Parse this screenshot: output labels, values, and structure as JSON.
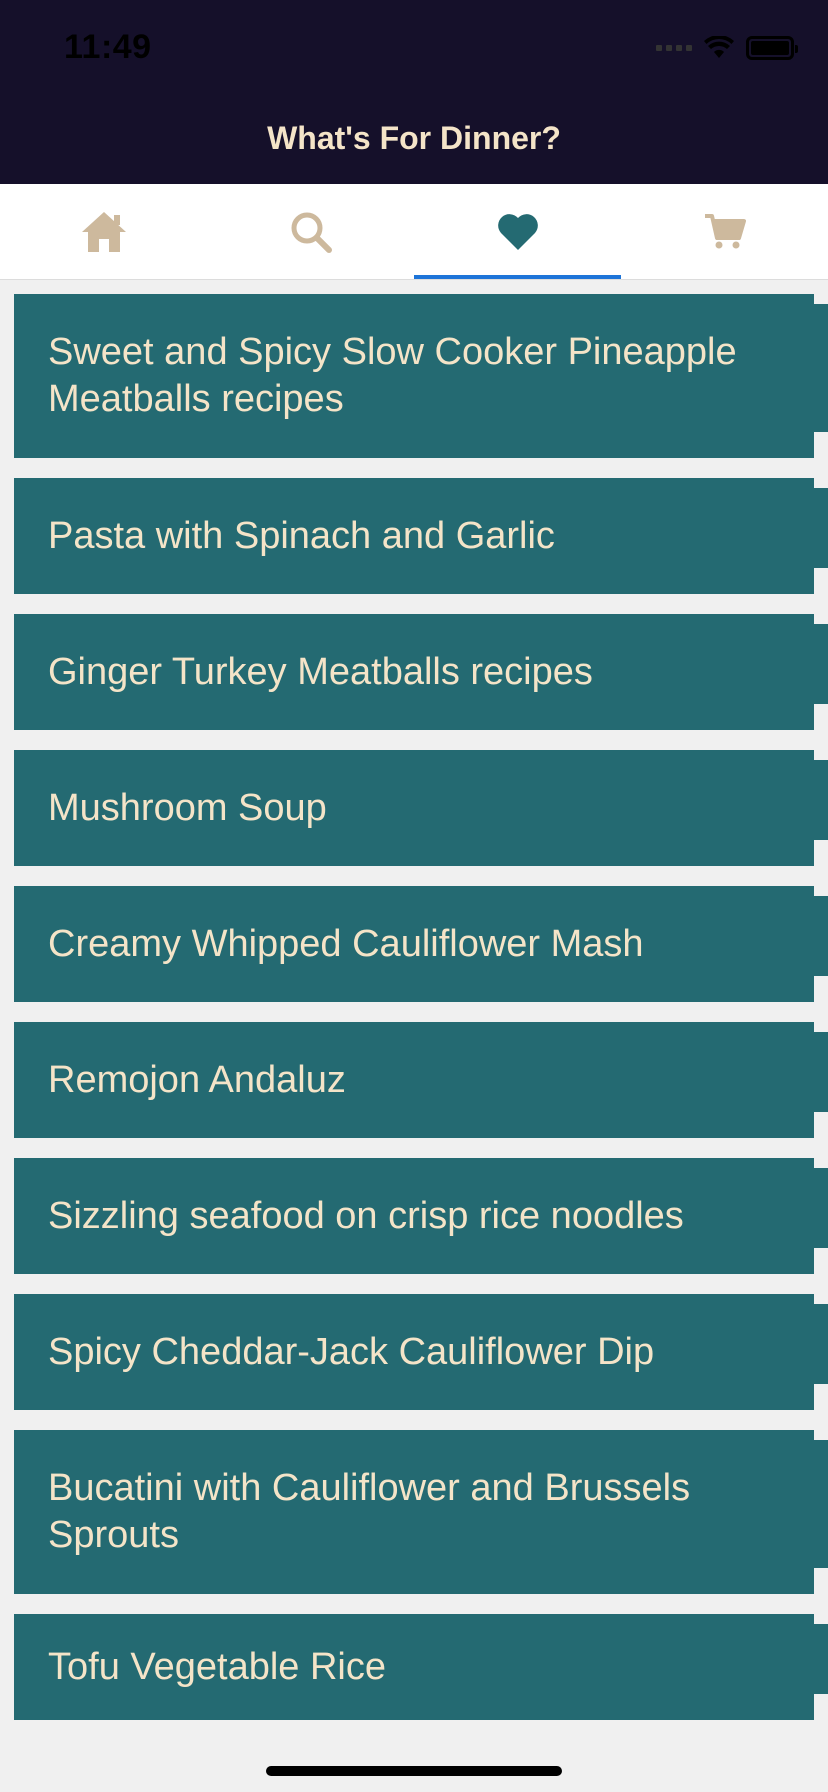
{
  "status_bar": {
    "time": "11:49"
  },
  "header": {
    "title": "What's For Dinner?"
  },
  "tabs": [
    {
      "icon": "home-icon",
      "active": false
    },
    {
      "icon": "search-icon",
      "active": false
    },
    {
      "icon": "heart-icon",
      "active": true
    },
    {
      "icon": "cart-icon",
      "active": false
    }
  ],
  "colors": {
    "header_bg": "#15102a",
    "title_text": "#f4e4c8",
    "card_bg": "#246a72",
    "card_text": "#f4e4c8",
    "tab_icon_inactive": "#cdb99d",
    "tab_icon_active": "#246a72",
    "tab_indicator": "#1d74d8",
    "list_bg": "#f0f0f0"
  },
  "favorites": [
    {
      "title": "Sweet and Spicy Slow Cooker Pineapple Meatballs recipes"
    },
    {
      "title": "Pasta with Spinach and Garlic"
    },
    {
      "title": "Ginger Turkey Meatballs recipes"
    },
    {
      "title": "Mushroom Soup"
    },
    {
      "title": "Creamy Whipped Cauliflower Mash"
    },
    {
      "title": "Remojon Andaluz"
    },
    {
      "title": "Sizzling seafood on crisp rice noodles"
    },
    {
      "title": "Spicy Cheddar-Jack Cauliflower Dip"
    },
    {
      "title": "Bucatini with Cauliflower and Brussels Sprouts"
    },
    {
      "title": "Tofu Vegetable Rice"
    }
  ]
}
